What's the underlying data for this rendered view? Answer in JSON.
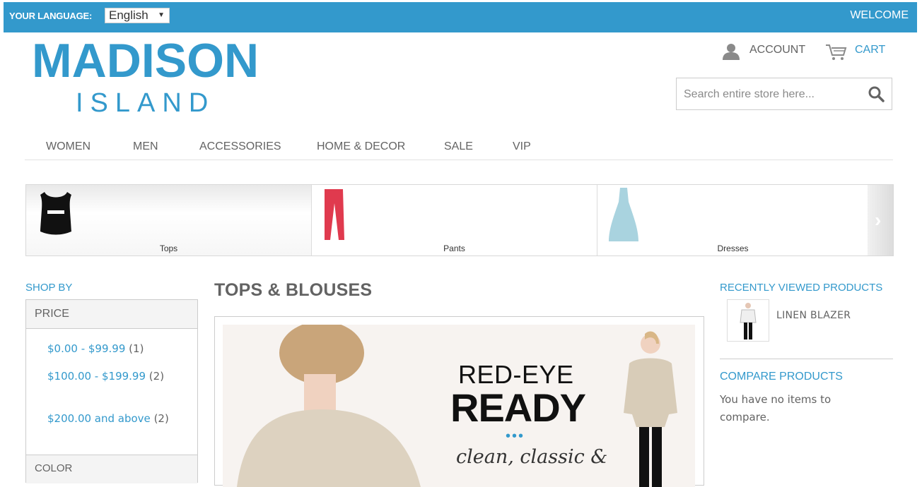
{
  "topbar": {
    "language_label": "YOUR LANGUAGE:",
    "language_selected": "English",
    "welcome": "WELCOME"
  },
  "logo": {
    "main": "MADISON",
    "sub": "ISLAND"
  },
  "header": {
    "account": "ACCOUNT",
    "cart": "CART",
    "search_placeholder": "Search entire store here..."
  },
  "nav": {
    "items": [
      "WOMEN",
      "MEN",
      "ACCESSORIES",
      "HOME & DECOR",
      "SALE",
      "VIP"
    ]
  },
  "carousel": {
    "items": [
      {
        "label": "Tops",
        "icon": "tank-top-icon"
      },
      {
        "label": "Pants",
        "icon": "pants-icon"
      },
      {
        "label": "Dresses",
        "icon": "dress-icon"
      }
    ],
    "next_icon": "chevron-right-icon"
  },
  "sidebar": {
    "shop_by": "SHOP BY",
    "price_heading": "PRICE",
    "price_filters": [
      {
        "range": "$0.00 - $99.99",
        "count": "(1)"
      },
      {
        "range": "$100.00 - $199.99",
        "count": "(2)"
      },
      {
        "range": "$200.00 and above",
        "count": "(2)"
      }
    ],
    "color_heading": "COLOR"
  },
  "main": {
    "title": "TOPS & BLOUSES",
    "banner": {
      "line1": "RED-EYE",
      "line2": "READY",
      "dots": "•••",
      "line3": "clean, classic &"
    }
  },
  "right": {
    "recent_title": "RECENTLY VIEWED PRODUCTS",
    "recent_items": [
      {
        "name": "LINEN BLAZER"
      }
    ],
    "compare_title": "COMPARE PRODUCTS",
    "compare_text": "You have no items to compare."
  },
  "colors": {
    "accent": "#3399cc",
    "text": "#636363"
  }
}
